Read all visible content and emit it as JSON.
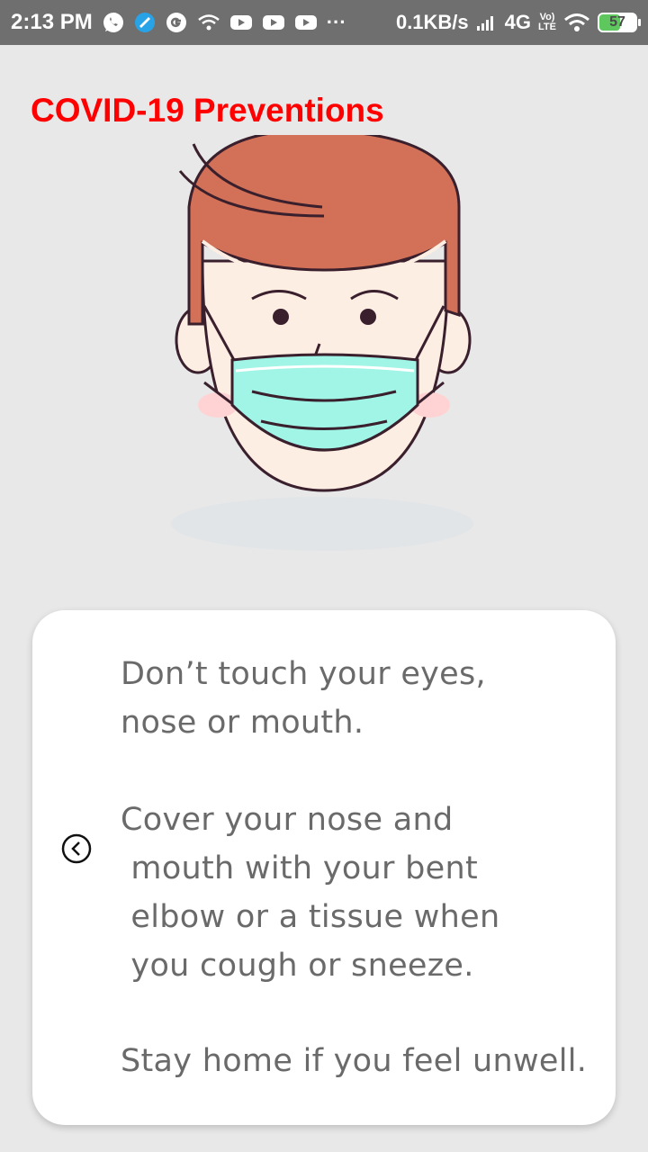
{
  "status_bar": {
    "time": "2:13 PM",
    "net_speed": "0.1KB/s",
    "network_type": "4G",
    "volte_top": "Vo)",
    "volte_bottom": "LTE",
    "battery": "57",
    "battery_level": 0.57,
    "icons": [
      "whatsapp-icon",
      "messenger-icon",
      "google-icon",
      "wifi-small-icon",
      "youtube-icon",
      "youtube-icon",
      "youtube-icon",
      "more-dots-icon",
      "signal-icon",
      "wifi-icon",
      "battery-icon"
    ],
    "overflow_dots": "···"
  },
  "header": {
    "title": "COVID-19 Preventions"
  },
  "illustration": {
    "icon": "face-mask-person",
    "colors": {
      "hair": "#d27157",
      "skin": "#fdeee3",
      "blush": "#ffd3d3",
      "mask": "#a0f5e6",
      "outline": "#3a1f2d"
    }
  },
  "card": {
    "tips": [
      "Don’t touch your eyes,\nnose or mouth.",
      "Cover your nose and\n mouth with your bent\n elbow or a tissue when\n you cough or sneeze.",
      "Stay home if you feel unwell."
    ],
    "back_icon": "chevron-left-circle-icon"
  },
  "colors": {
    "title": "#ff0000",
    "text": "#6a6a6a",
    "background": "#e8e8e8",
    "status_bar": "#6f6f6f"
  }
}
